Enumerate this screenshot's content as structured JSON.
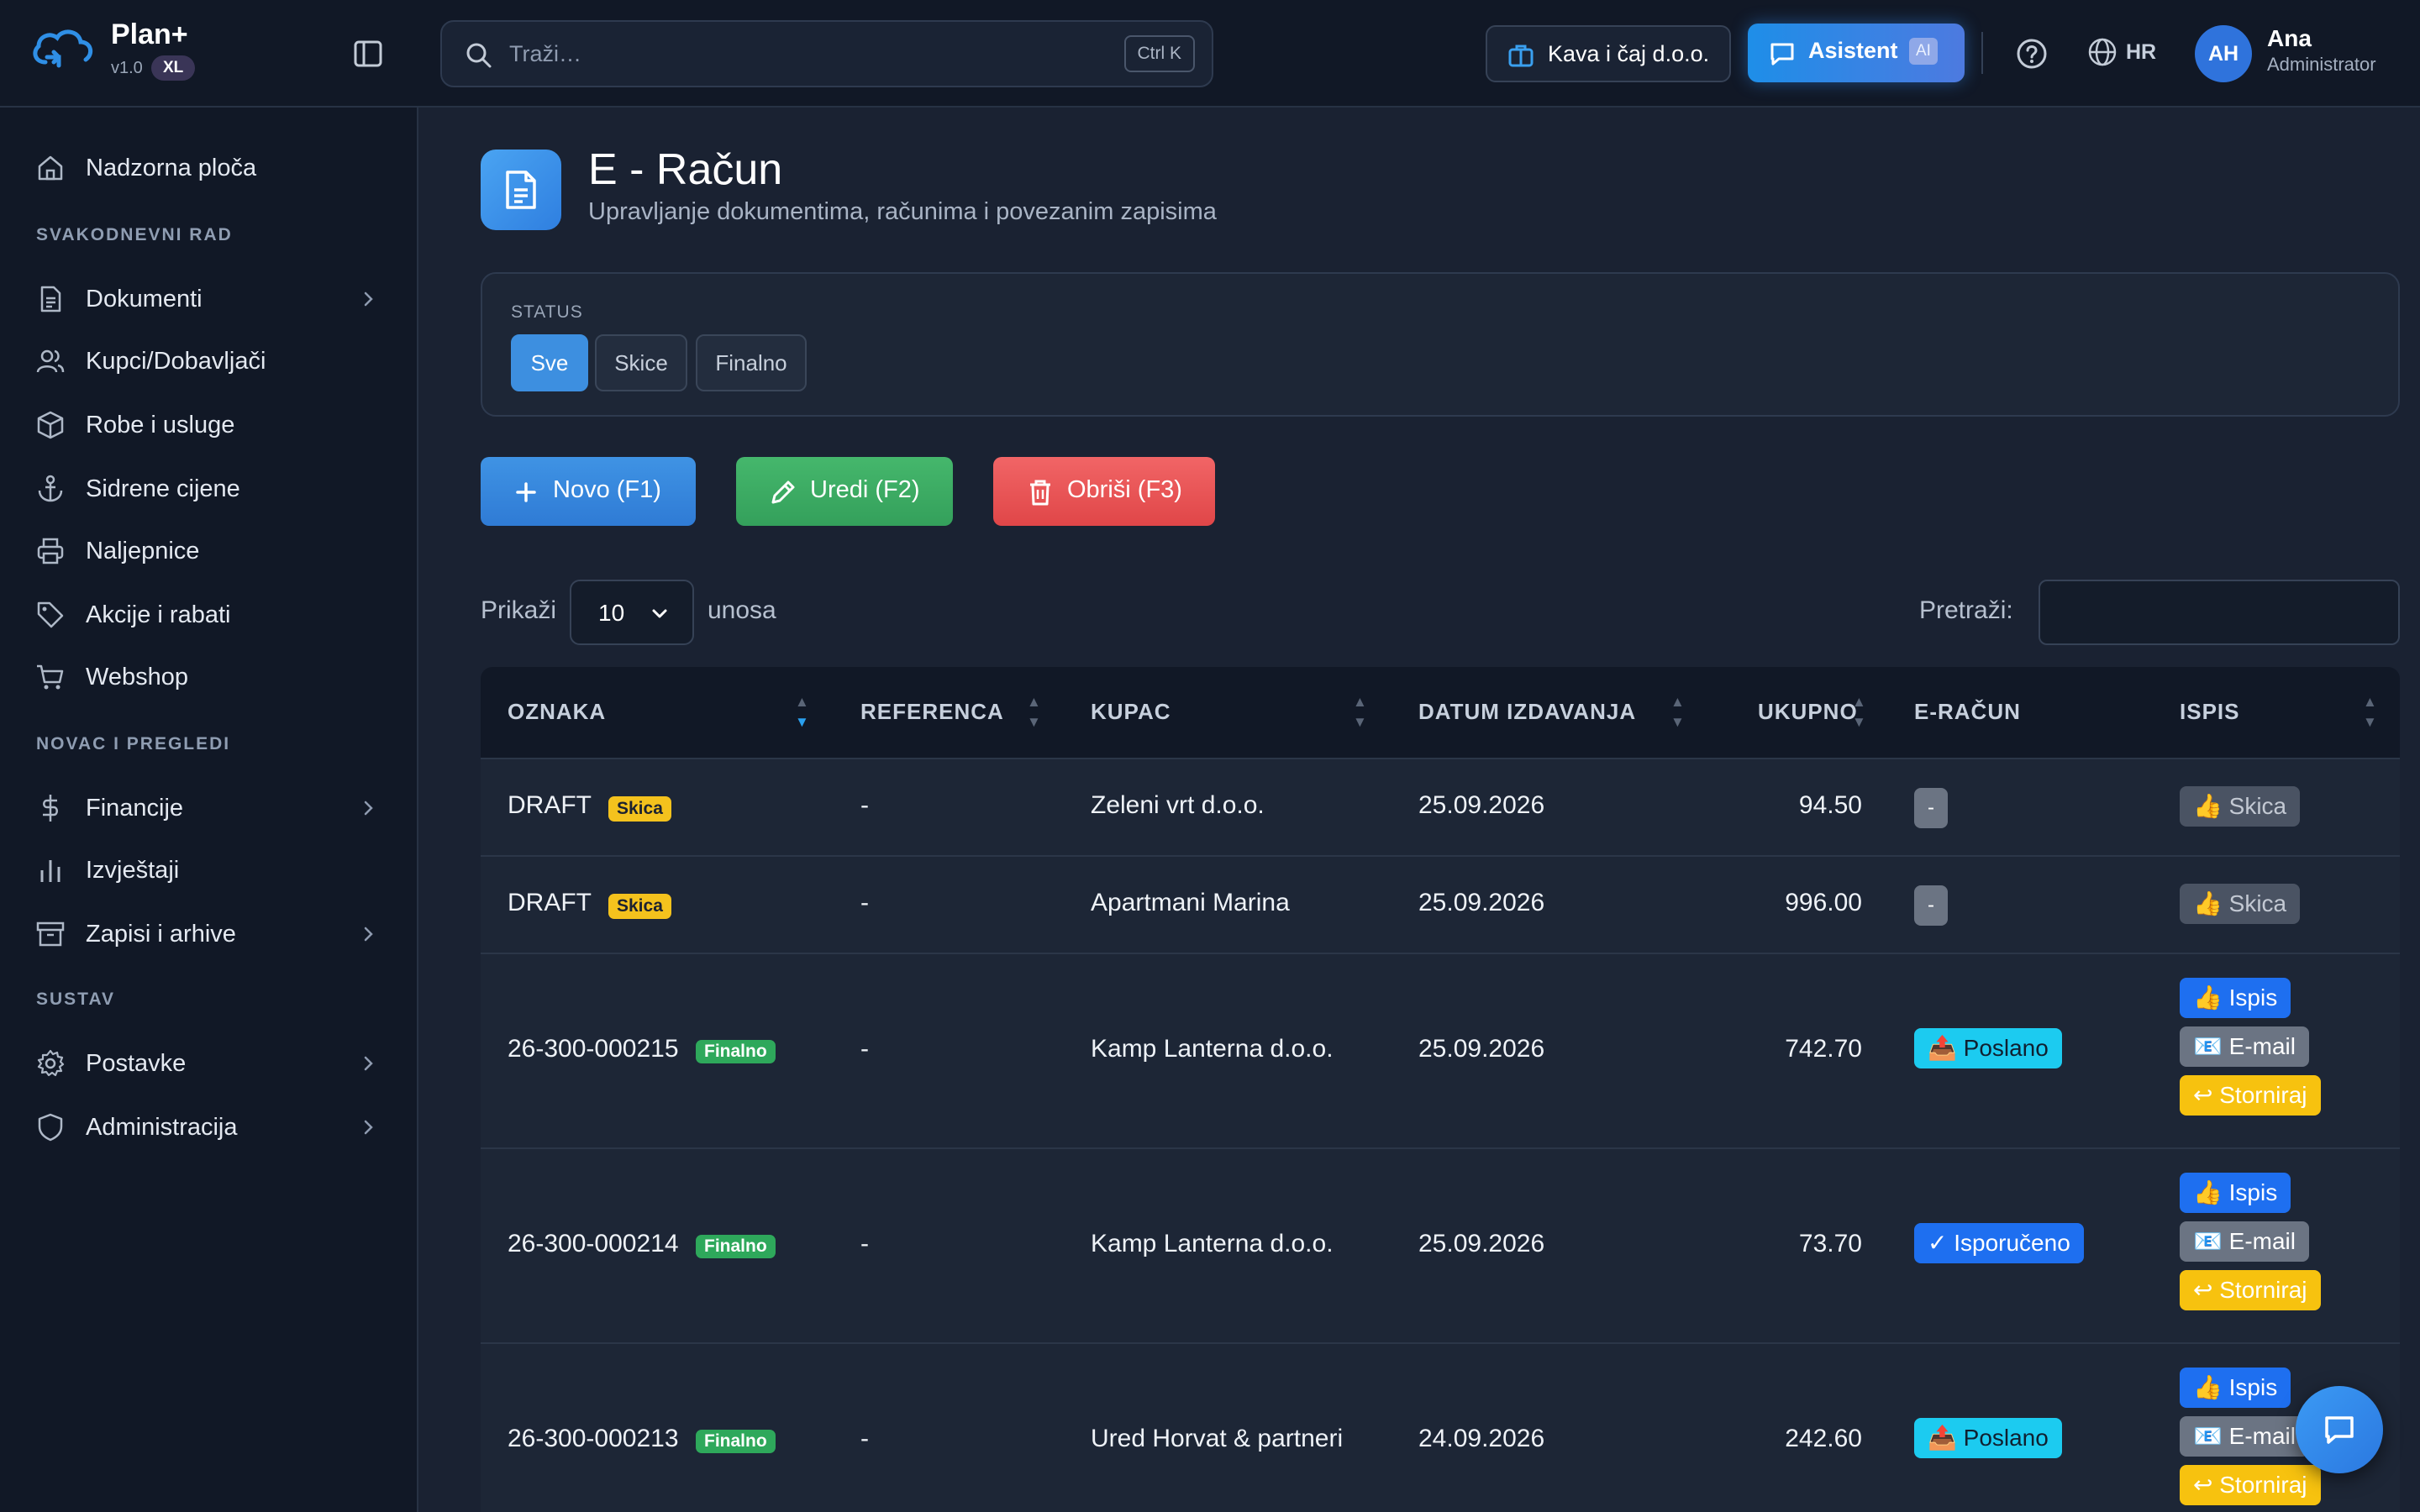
{
  "brand": {
    "name": "Plan+",
    "version": "v1.0",
    "badge": "XL"
  },
  "search": {
    "placeholder": "Traži…",
    "shortcut": "Ctrl K"
  },
  "header": {
    "company": "Kava i čaj d.o.o.",
    "assistant_label": "Asistent",
    "assistant_badge": "AI",
    "language": "HR",
    "user": {
      "initials": "AH",
      "name": "Ana",
      "role": "Administrator"
    }
  },
  "sidebar": {
    "dashboard": "Nadzorna ploča",
    "sections": [
      "SVAKODNEVNI RAD",
      "NOVAC I PREGLEDI",
      "SUSTAV"
    ],
    "items": [
      {
        "label": "Dokumenti",
        "icon": "file-text-icon",
        "has_children": true
      },
      {
        "label": "Kupci/Dobavljači",
        "icon": "users-icon",
        "has_children": false
      },
      {
        "label": "Robe i usluge",
        "icon": "box-icon",
        "has_children": false
      },
      {
        "label": "Sidrene cijene",
        "icon": "anchor-icon",
        "has_children": false
      },
      {
        "label": "Naljepnice",
        "icon": "printer-icon",
        "has_children": false
      },
      {
        "label": "Akcije i rabati",
        "icon": "tag-icon",
        "has_children": false
      },
      {
        "label": "Webshop",
        "icon": "cart-icon",
        "has_children": false
      },
      {
        "label": "Financije",
        "icon": "dollar-icon",
        "has_children": true
      },
      {
        "label": "Izvještaji",
        "icon": "bar-chart-icon",
        "has_children": false
      },
      {
        "label": "Zapisi i arhive",
        "icon": "archive-icon",
        "has_children": true
      },
      {
        "label": "Postavke",
        "icon": "gear-icon",
        "has_children": true
      },
      {
        "label": "Administracija",
        "icon": "shield-icon",
        "has_children": true
      }
    ]
  },
  "page": {
    "title": "E - Račun",
    "subtitle": "Upravljanje dokumentima, računima i povezanim zapisima"
  },
  "filter": {
    "label": "STATUS",
    "options": [
      "Sve",
      "Skice",
      "Finalno"
    ],
    "selected": "Sve"
  },
  "actions": {
    "new": "Novo (F1)",
    "edit": "Uredi (F2)",
    "delete": "Obriši (F3)"
  },
  "table_controls": {
    "show_label": "Prikaži",
    "page_size": "10",
    "entries_label": "unosa",
    "search_label": "Pretraži:"
  },
  "table": {
    "columns": [
      "OZNAKA",
      "REFERENCA",
      "KUPAC",
      "DATUM IZDAVANJA",
      "UKUPNO",
      "E-RAČUN",
      "ISPIS"
    ],
    "rows": [
      {
        "oznaka": "DRAFT",
        "tag": "Skica",
        "referenca": "-",
        "kupac": "Zeleni vrt d.o.o.",
        "datum": "25.09.2026",
        "ukupno": "94.50",
        "eracun": "-",
        "ispis": [
          "👍 Skica"
        ]
      },
      {
        "oznaka": "DRAFT",
        "tag": "Skica",
        "referenca": "-",
        "kupac": "Apartmani Marina",
        "datum": "25.09.2026",
        "ukupno": "996.00",
        "eracun": "-",
        "ispis": [
          "👍 Skica"
        ]
      },
      {
        "oznaka": "26-300-000215",
        "tag": "Finalno",
        "referenca": "-",
        "kupac": "Kamp Lanterna d.o.o.",
        "datum": "25.09.2026",
        "ukupno": "742.70",
        "eracun": "📤 Poslano",
        "ispis": [
          "👍 Ispis",
          "📧 E-mail",
          "↩ Storniraj"
        ]
      },
      {
        "oznaka": "26-300-000214",
        "tag": "Finalno",
        "referenca": "-",
        "kupac": "Kamp Lanterna d.o.o.",
        "datum": "25.09.2026",
        "ukupno": "73.70",
        "eracun": "✓ Isporučeno",
        "ispis": [
          "👍 Ispis",
          "📧 E-mail",
          "↩ Storniraj"
        ]
      },
      {
        "oznaka": "26-300-000213",
        "tag": "Finalno",
        "referenca": "-",
        "kupac": "Ured Horvat & partneri",
        "datum": "24.09.2026",
        "ukupno": "242.60",
        "eracun": "📤 Poslano",
        "ispis": [
          "👍 Ispis",
          "📧 E-mail",
          "↩ Storniraj"
        ]
      }
    ]
  },
  "colors": {
    "accent": "#3d8fe0",
    "success": "#34a05b",
    "danger": "#e04648",
    "warning": "#f7c20f",
    "info": "#1ccbf0"
  }
}
